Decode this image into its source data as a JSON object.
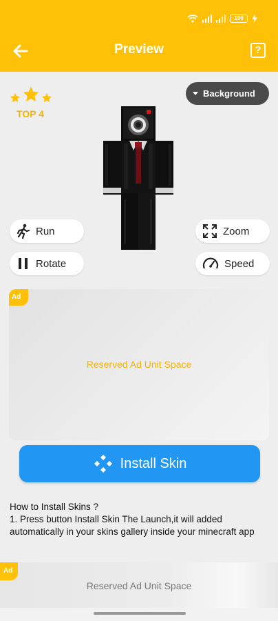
{
  "status_bar": {
    "battery": "100",
    "icons": [
      "wifi-icon",
      "signal-icon",
      "signal-icon",
      "battery-icon",
      "charging-icon"
    ]
  },
  "header": {
    "title": "Preview",
    "back_icon": "arrow-left-icon",
    "help_label": "?",
    "color": "#ffc107"
  },
  "preview": {
    "rank_label": "TOP 4",
    "stars": 3,
    "background_button": "Background",
    "controls": {
      "run": "Run",
      "rotate": "Rotate",
      "zoom": "Zoom",
      "speed": "Speed"
    }
  },
  "ad_unit": {
    "badge": "Ad",
    "text": "Reserved Ad Unit Space"
  },
  "install_button": {
    "label": "Install Skin",
    "color": "#2196f3"
  },
  "instructions": {
    "heading": "How to Install Skins ?",
    "step1": " 1. Press button Install Skin The Launch,it will added automatically in your skins gallery inside your minecraft app"
  },
  "bottom_ad": {
    "badge": "Ad",
    "text": "Reserved Ad Unit Space"
  }
}
